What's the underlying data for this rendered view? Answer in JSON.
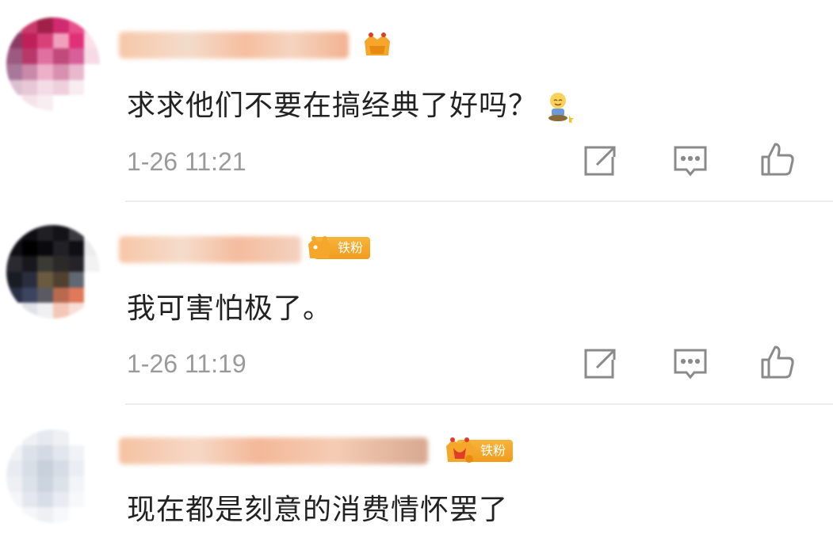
{
  "comments": [
    {
      "text": "求求他们不要在搞经典了好吗？",
      "time": "1-26 11:21",
      "badge": ""
    },
    {
      "text": "我可害怕极了。",
      "time": "1-26 11:19",
      "badge": "铁粉"
    },
    {
      "text": "现在都是刻意的消费情怀罢了",
      "time": "",
      "badge": "铁粉"
    }
  ],
  "colors": {
    "badge": "#f4a72a",
    "icon": "#8a8a8a",
    "time": "#9a9a9a",
    "text": "#222222"
  },
  "icons": [
    "repost-icon",
    "comment-icon",
    "like-icon",
    "crown-badge-icon",
    "emoji-icon"
  ]
}
